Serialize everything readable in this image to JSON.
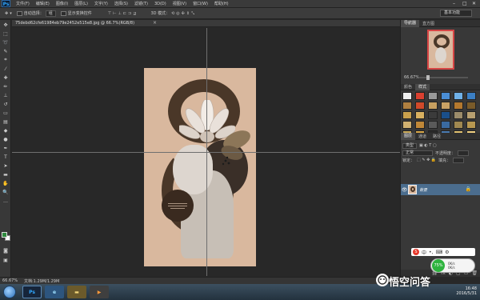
{
  "menubar": {
    "logo": "Ps",
    "items": [
      "文件(F)",
      "编辑(E)",
      "图像(I)",
      "图层(L)",
      "文字(Y)",
      "选择(S)",
      "滤镜(T)",
      "3D(D)",
      "视图(V)",
      "窗口(W)",
      "帮助(H)"
    ],
    "window_controls": [
      "–",
      "□",
      "✕"
    ]
  },
  "options": {
    "auto_select_label": "自动选择：",
    "auto_select_value": "组",
    "show_transform_label": "显示变换控件",
    "mode_3d_label": "3D 模式：",
    "workspace_label": "基本功能"
  },
  "document": {
    "tab_label": "75debd62cfe61984eb79e2452e515e8.jpg @ 66.7%(RGB/8)",
    "close_glyph": "×",
    "zoom_status": "66.67%",
    "doc_status": "文档:1.29M/1.29M"
  },
  "navigator": {
    "tabs": [
      "导航器",
      "直方图"
    ],
    "zoom": "66.67%"
  },
  "styles_panel": {
    "tabs": [
      "颜色",
      "样式"
    ],
    "swatches": [
      "#f0f0f0",
      "#d94030",
      "#9a9a9a",
      "#4a8ed6",
      "#6fb1e8",
      "#3b7fc4",
      "#b08040",
      "#d04a2a",
      "#c8a060",
      "#caa264",
      "#b3782e",
      "#7a5b2a",
      "#c9a04c",
      "#d8b060",
      "#3b3b3b",
      "#1a4f8a",
      "#9c8c6a",
      "#b8a070",
      "#d0b070",
      "#c08838",
      "#5a5a5a",
      "#3a6aa0",
      "#a08850",
      "#b89850",
      "#c8a858",
      "#d8a848",
      "#2a2a2a",
      "#4a7ab0",
      "#e0c070",
      "#f0d080"
    ]
  },
  "layers_panel": {
    "tabs": [
      "图层",
      "通道",
      "路径"
    ],
    "kind_label": "类型",
    "blend_mode": "正常",
    "opacity_label": "不透明度：",
    "lock_label": "锁定：",
    "fill_label": "填充：",
    "layer_name": "背景",
    "footer_icons": [
      "fx",
      "◐",
      "▢",
      "▭",
      "🗑"
    ]
  },
  "taskbar": {
    "apps": [
      "Ps",
      "e",
      "",
      ""
    ],
    "time": "16:48",
    "date": "2016/5/31"
  },
  "overlay": {
    "watermark": "悟空问答",
    "speed_percent": "75%",
    "speed_up": "0K/s",
    "speed_down": "0K/s",
    "ime_label": "中"
  },
  "colors": {
    "foreground": "#2e8b3e",
    "background": "#ffffff",
    "poster_bg": "#d9b89e",
    "poster_accent": "#4a3728",
    "layer_selected": "#4b6d8e"
  }
}
